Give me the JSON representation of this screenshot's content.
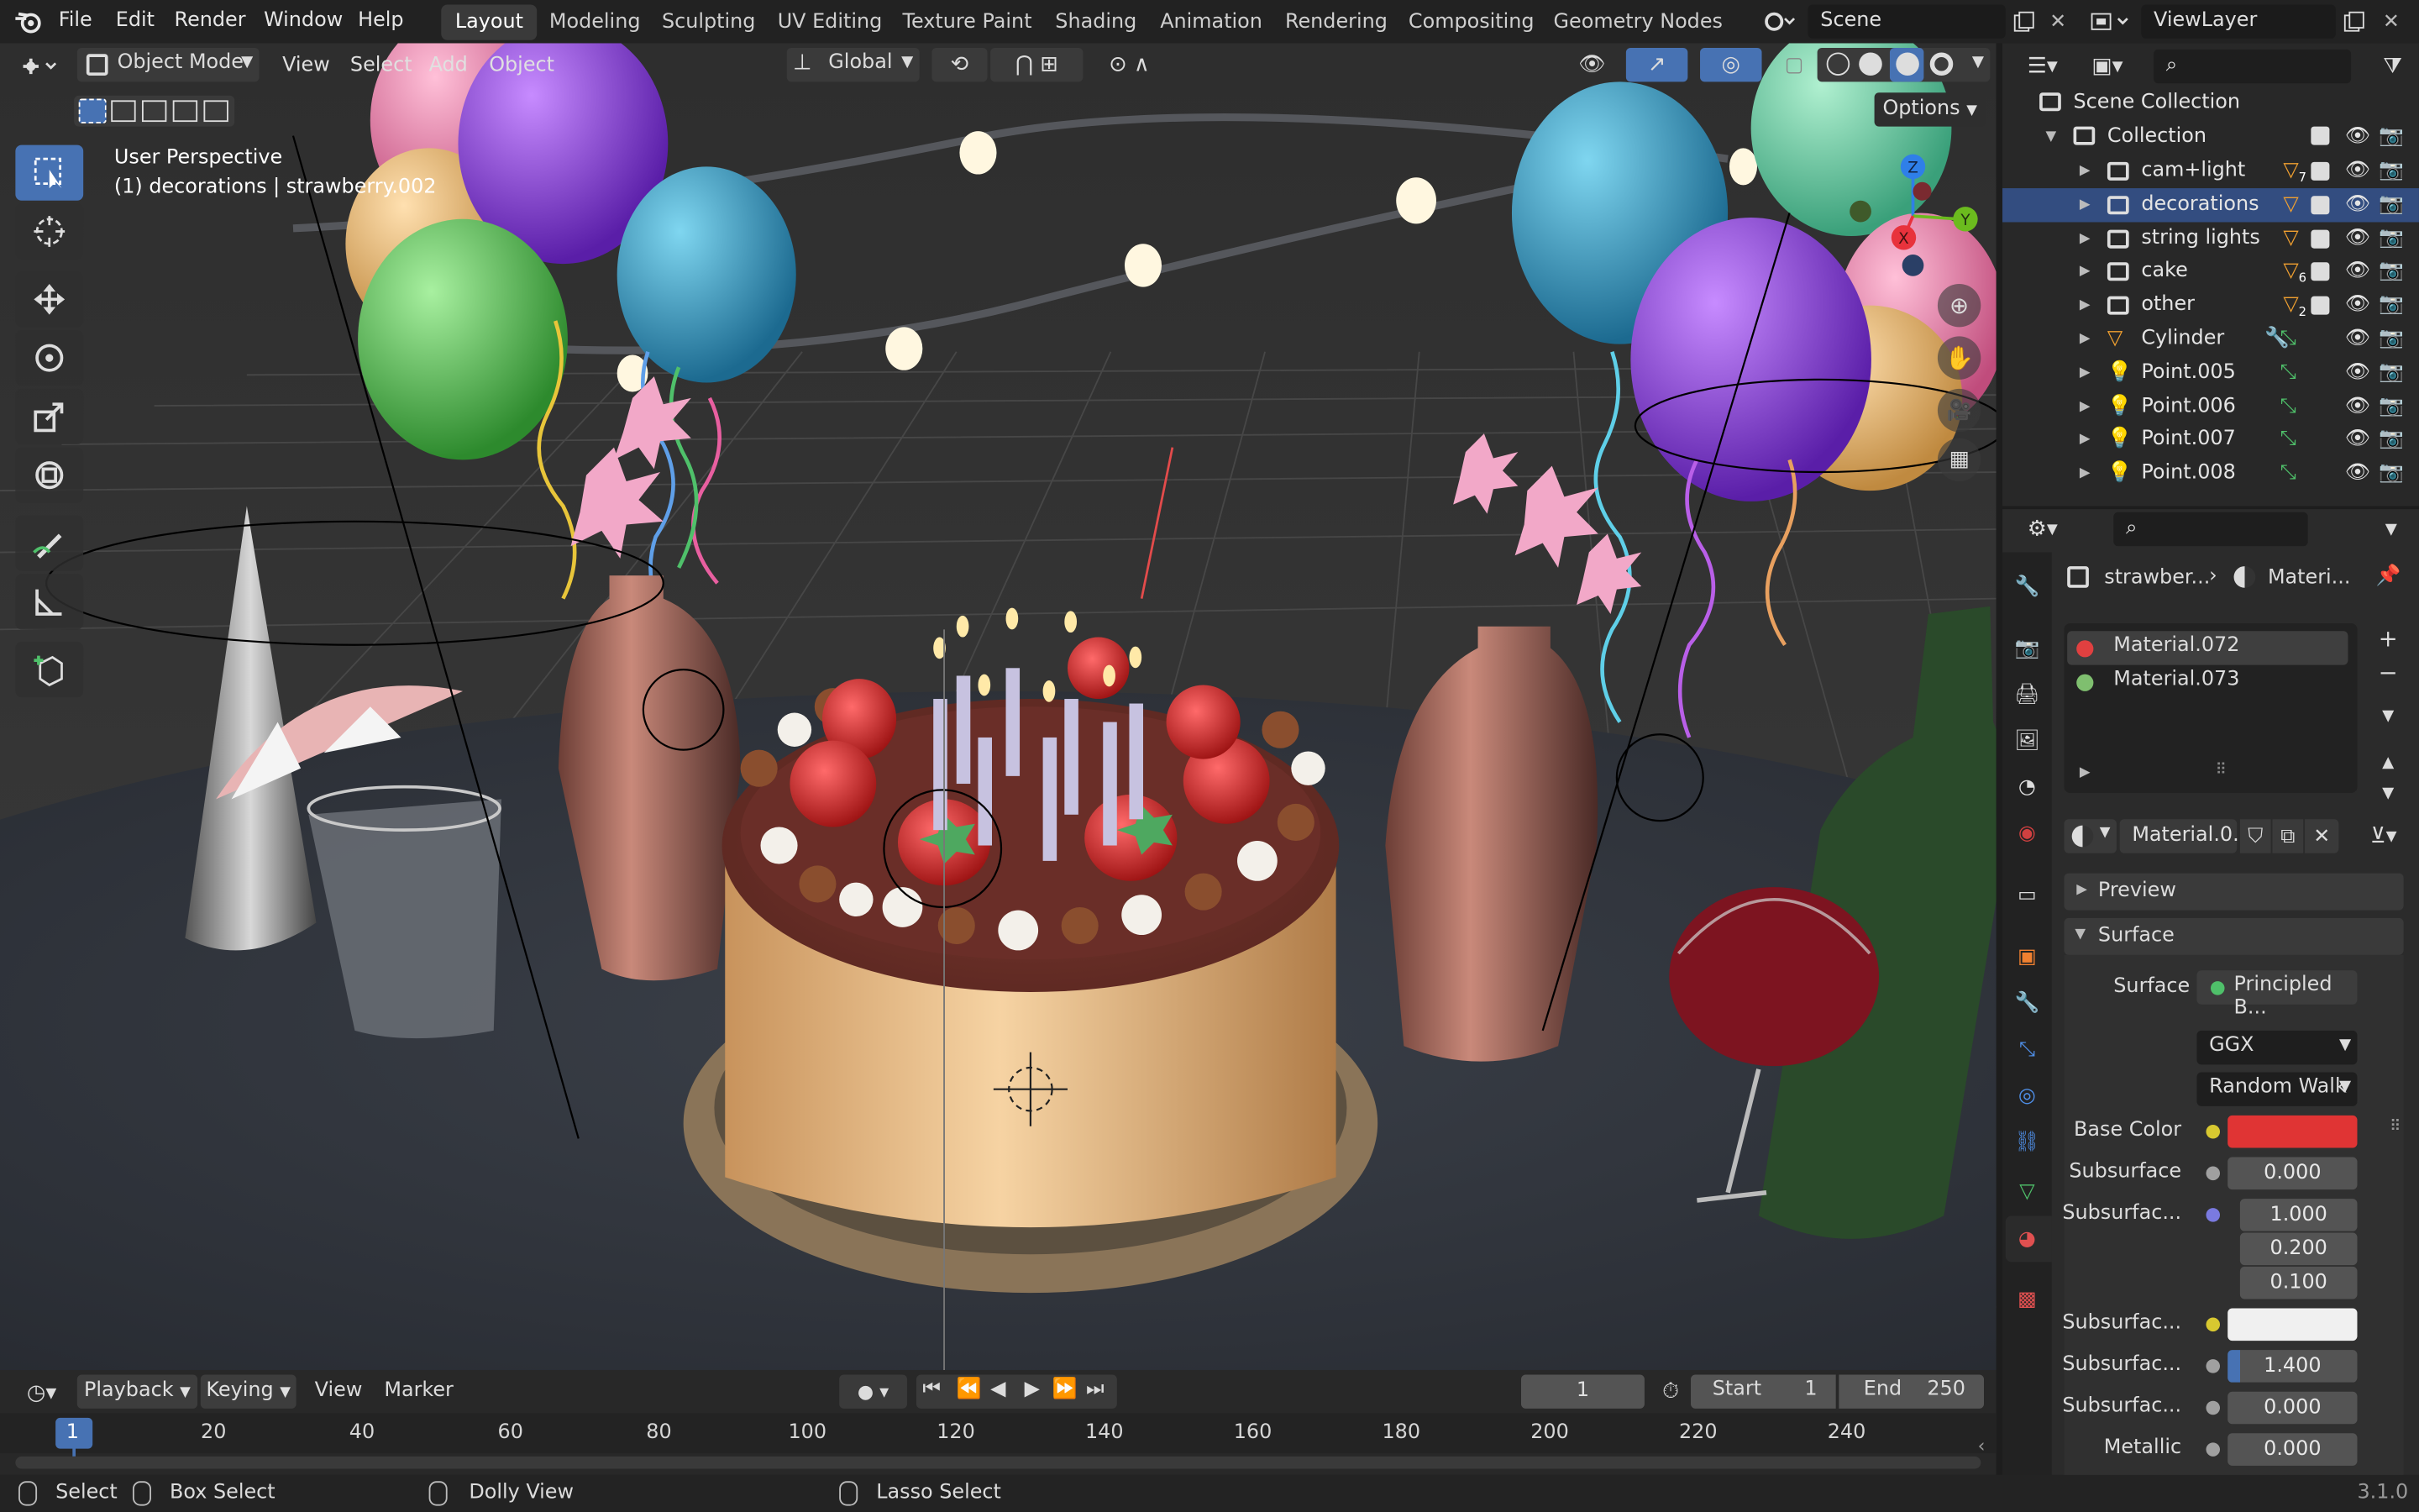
{
  "menubar": {
    "items": [
      "File",
      "Edit",
      "Render",
      "Window",
      "Help"
    ],
    "workspaces": [
      "Layout",
      "Modeling",
      "Sculpting",
      "UV Editing",
      "Texture Paint",
      "Shading",
      "Animation",
      "Rendering",
      "Compositing",
      "Geometry Nodes"
    ],
    "scene": "Scene",
    "view_layer": "ViewLayer"
  },
  "viewport_header": {
    "mode": "Object Mode",
    "menus": [
      "View",
      "Select",
      "Add",
      "Object"
    ],
    "transform_orientation": "Global",
    "options": "Options"
  },
  "viewport": {
    "perspective_label": "User Perspective",
    "object_label": "(1) decorations | strawberry.002",
    "axes": {
      "x": "X",
      "y": "Y",
      "z": "Z"
    },
    "colors": {
      "x": "#e8323c",
      "y": "#6bbb1e",
      "z": "#2f7fe8"
    }
  },
  "outliner": {
    "root": "Scene Collection",
    "collection": "Collection",
    "rows": [
      {
        "label": "cam+light",
        "badge": "7"
      },
      {
        "label": "decorations",
        "badge": ""
      },
      {
        "label": "string lights",
        "badge": ""
      },
      {
        "label": "cake",
        "badge": "6"
      },
      {
        "label": "other",
        "badge": "2"
      },
      {
        "label": "Cylinder",
        "badge": ""
      },
      {
        "label": "Point.005",
        "badge": ""
      },
      {
        "label": "Point.006",
        "badge": ""
      },
      {
        "label": "Point.007",
        "badge": ""
      },
      {
        "label": "Point.008",
        "badge": ""
      }
    ],
    "selected_row": "decorations"
  },
  "properties": {
    "breadcrumb_object": "strawber...",
    "breadcrumb_material": "Materi...",
    "material_slots": [
      {
        "name": "Material.072",
        "color": "#e04040"
      },
      {
        "name": "Material.073",
        "color": "#7fbf6f"
      }
    ],
    "material_name": "Material.0...",
    "panels": {
      "preview": "Preview",
      "surface": "Surface"
    },
    "surface_label": "Surface",
    "surface_value": "Principled B...",
    "distribution": "GGX",
    "subsurface_method": "Random Walk",
    "fields": [
      {
        "label": "Base Color",
        "value": "",
        "dot": "#d8c830"
      },
      {
        "label": "Subsurface",
        "value": "0.000",
        "dot": "#a0a0a0"
      },
      {
        "label": "Subsurfac...",
        "value": "1.000",
        "dot": "#7a7ae0"
      },
      {
        "label": "",
        "value": "0.200",
        "dot": ""
      },
      {
        "label": "",
        "value": "0.100",
        "dot": ""
      },
      {
        "label": "Subsurfac...",
        "value": "",
        "dot": "#d8c830"
      },
      {
        "label": "Subsurfac...",
        "value": "1.400",
        "dot": "#a0a0a0"
      },
      {
        "label": "Subsurfac...",
        "value": "0.000",
        "dot": "#a0a0a0"
      },
      {
        "label": "Metallic",
        "value": "0.000",
        "dot": "#a0a0a0"
      }
    ],
    "base_color": "#e03434",
    "subsurface_color": "#f0f0f0"
  },
  "timeline": {
    "menus": [
      "Playback",
      "Keying",
      "View",
      "Marker"
    ],
    "current_frame": "1",
    "start_label": "Start",
    "start": "1",
    "end_label": "End",
    "end": "250",
    "ticks": [
      "1",
      "20",
      "40",
      "60",
      "80",
      "100",
      "120",
      "140",
      "160",
      "180",
      "200",
      "220",
      "240"
    ]
  },
  "statusbar": {
    "select": "Select",
    "box_select": "Box Select",
    "dolly": "Dolly View",
    "lasso": "Lasso Select",
    "version": "3.1.0"
  }
}
